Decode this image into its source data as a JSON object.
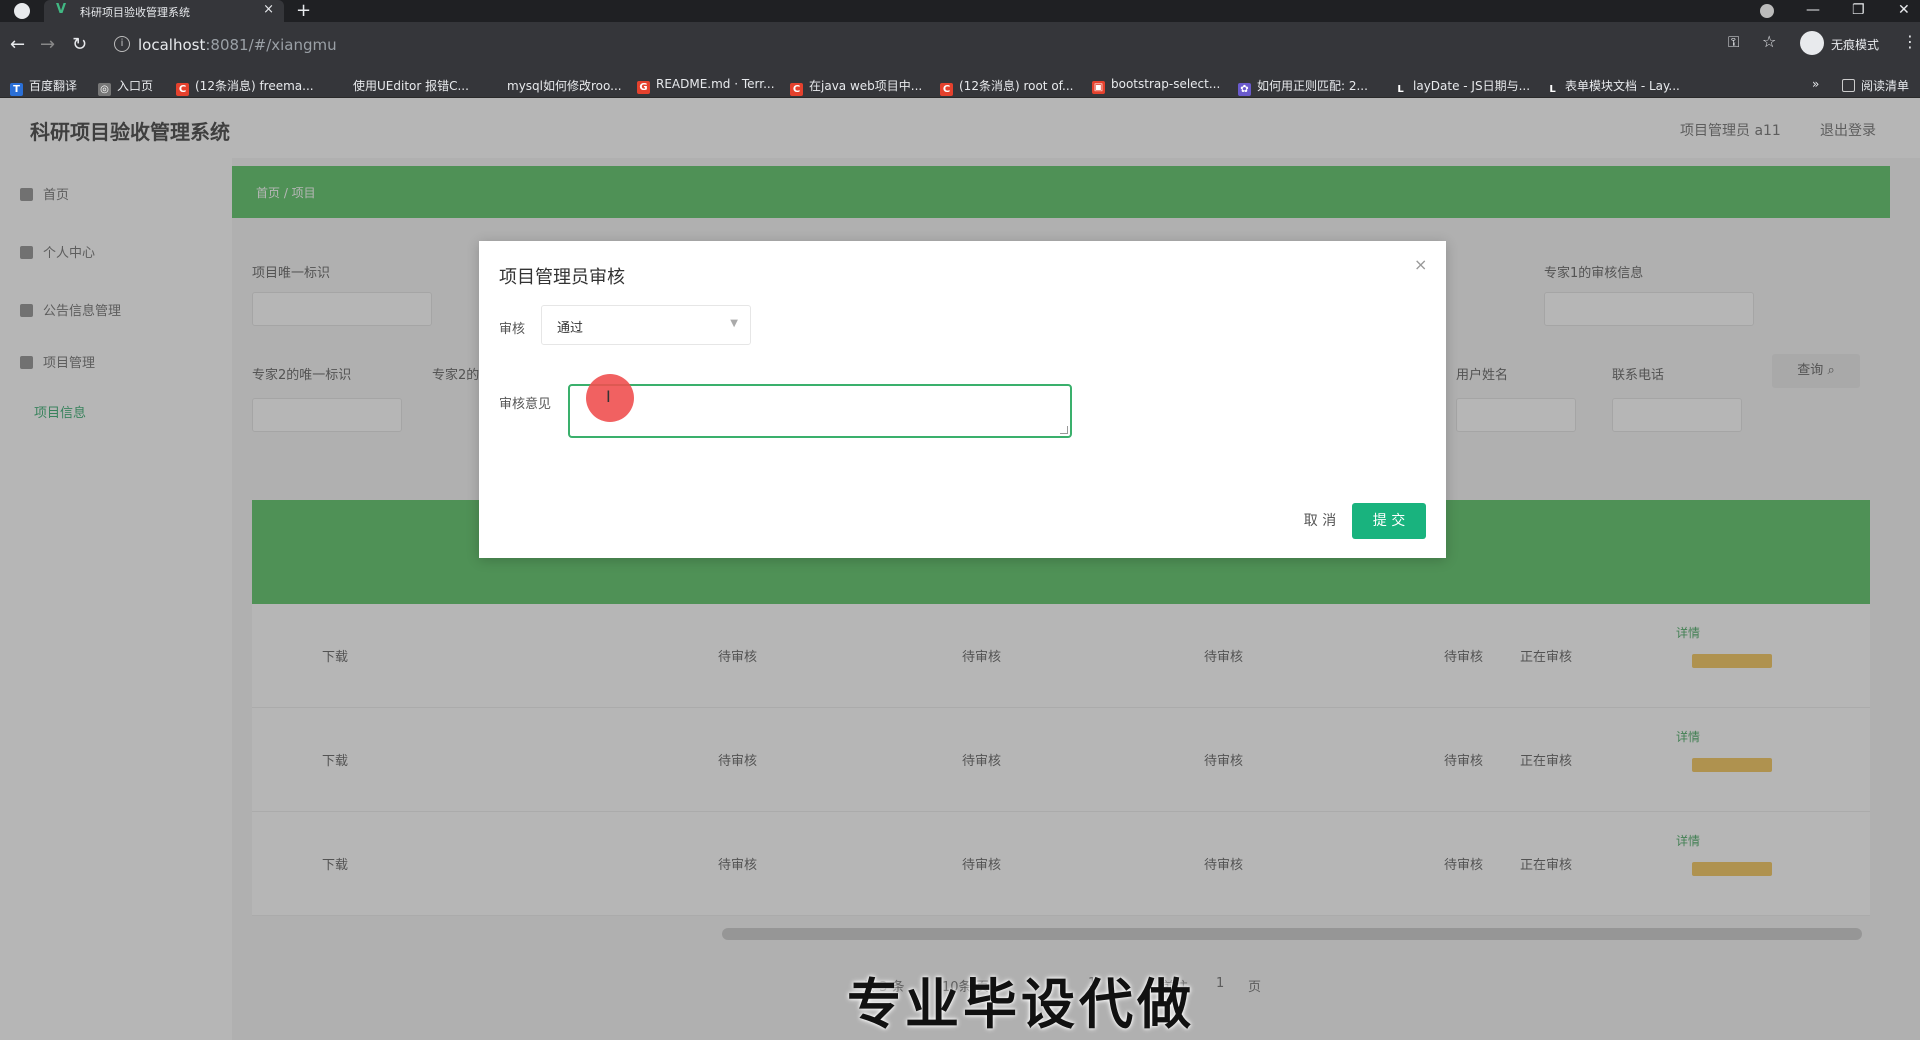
{
  "browser": {
    "tab_title": "科研项目验收管理系统",
    "tab_close": "×",
    "new_tab": "+",
    "url_host": "localhost",
    "url_rest": ":8081/#/xiangmu",
    "incognito_label": "无痕模式",
    "bookmarks": [
      {
        "label": "百度翻译",
        "color": "#2a6fd6"
      },
      {
        "label": "入口页",
        "color": "#777777"
      },
      {
        "label": "(12条消息) freema...",
        "color": "#e5412d"
      },
      {
        "label": "使用UEditor 报错C...",
        "color": "#35363a"
      },
      {
        "label": "mysql如何修改roo...",
        "color": "#35363a"
      },
      {
        "label": "README.md · Terr...",
        "color": "#e5412d"
      },
      {
        "label": "在java web项目中...",
        "color": "#e5412d"
      },
      {
        "label": "(12条消息) root of...",
        "color": "#e5412d"
      },
      {
        "label": "bootstrap-select...",
        "color": "#e5412d"
      },
      {
        "label": "如何用正则匹配: 2...",
        "color": "#6a5acd"
      },
      {
        "label": "layDate - JS日期与...",
        "color": "#35363a"
      },
      {
        "label": "表单模块文档 - Lay...",
        "color": "#35363a"
      }
    ],
    "bookmarks_more": "»",
    "reading_list": "阅读清单"
  },
  "app": {
    "title": "科研项目验收管理系统",
    "header_user": "项目管理员 a11",
    "header_logout": "退出登录",
    "sidebar": [
      {
        "label": "首页"
      },
      {
        "label": "个人中心"
      },
      {
        "label": "公告信息管理"
      },
      {
        "label": "项目管理"
      }
    ],
    "sidebar_sub": "项目信息",
    "breadcrumb": "首页 / 项目",
    "filters": {
      "f1": "项目唯一标识",
      "f2": "专家1的审核信息",
      "f3": "专家2的唯一标识",
      "f4": "专家2的",
      "f5": "用户姓名",
      "f6": "联系电话",
      "query": "查询"
    },
    "rows": [
      {
        "download": "下载",
        "s1": "待审核",
        "s2": "待审核",
        "s3": "待审核",
        "s4": "待审核",
        "status": "正在审核",
        "detail": "详情"
      },
      {
        "download": "下载",
        "s1": "待审核",
        "s2": "待审核",
        "s3": "待审核",
        "s4": "待审核",
        "status": "正在审核",
        "detail": "详情"
      },
      {
        "download": "下载",
        "s1": "待审核",
        "s2": "待审核",
        "s3": "待审核",
        "s4": "待审核",
        "status": "正在审核",
        "detail": "详情"
      }
    ],
    "pager": {
      "total": "共 3 条",
      "size": "10条/页",
      "page": "1",
      "goto": "前往",
      "page_no": "1",
      "unit": "页"
    }
  },
  "modal": {
    "title": "项目管理员审核",
    "close": "×",
    "review_label": "审核",
    "review_value": "通过",
    "opinion_label": "审核意见",
    "opinion_value": "",
    "cancel": "取 消",
    "submit": "提 交",
    "accent_color": "#19b37e"
  },
  "watermark": "专业毕设代做"
}
